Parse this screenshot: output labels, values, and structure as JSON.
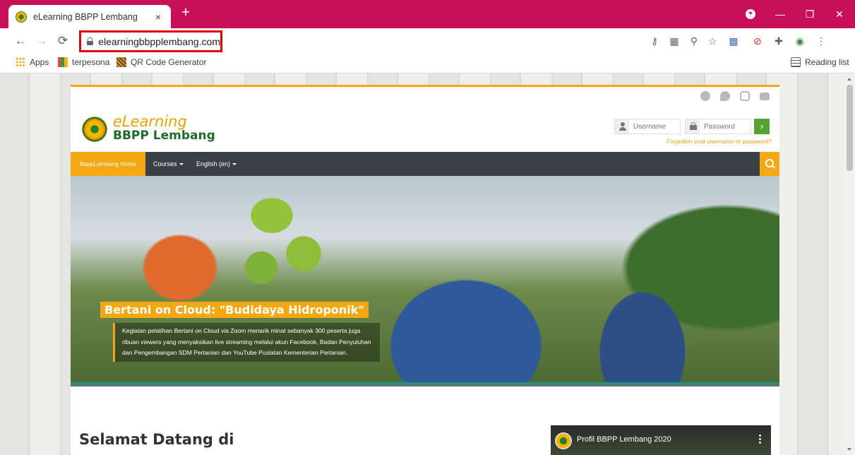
{
  "browser": {
    "tab_title": "eLearning BBPP Lembang",
    "tab_close": "×",
    "new_tab": "+",
    "url": "elearningbbpplembang.com",
    "window_minimize": "—",
    "window_restore": "❐",
    "window_close": "✕"
  },
  "bookmarks": {
    "items": [
      {
        "label": "Apps",
        "icon": "apps-grid-icon"
      },
      {
        "label": "terpesona",
        "icon": "terpesona-favicon"
      },
      {
        "label": "QR Code Generator",
        "icon": "qr-code-favicon"
      }
    ],
    "reading_list": "Reading list"
  },
  "site": {
    "logo": {
      "line1": "eLearning",
      "line2": "BBPP Lembang"
    },
    "social": [
      "facebook-icon",
      "twitter-icon",
      "instagram-icon",
      "youtube-icon"
    ],
    "login": {
      "username_placeholder": "Username",
      "password_placeholder": "Password",
      "submit": "›",
      "forgot": "Forgotten your username or password?"
    },
    "nav": {
      "home": "BbppLembang Home",
      "courses": "Courses",
      "language": "English (en)"
    },
    "hero": {
      "title": "Bertani on Cloud: \"Budidaya Hidroponik\"",
      "description": "Kegiatan pelatihan Bertani on Cloud via Zoom menarik minat sebanyak 300 peserta juga ribuan viewers yang menyaksikan live streaming melalui akun Facebook, Badan Penyuluhan dan Pengembangan SDM Pertanian dan YouTube Puslatan Kementerian Pertanian."
    },
    "welcome": "Selamat Datang di",
    "video": {
      "title": "Profil BBPP Lembang 2020"
    }
  },
  "colors": {
    "tabstrip": "#c8105a",
    "accent_orange": "#f3a712",
    "nav_dark": "#3b4046",
    "login_green": "#57a332",
    "url_highlight": "#e30000"
  }
}
